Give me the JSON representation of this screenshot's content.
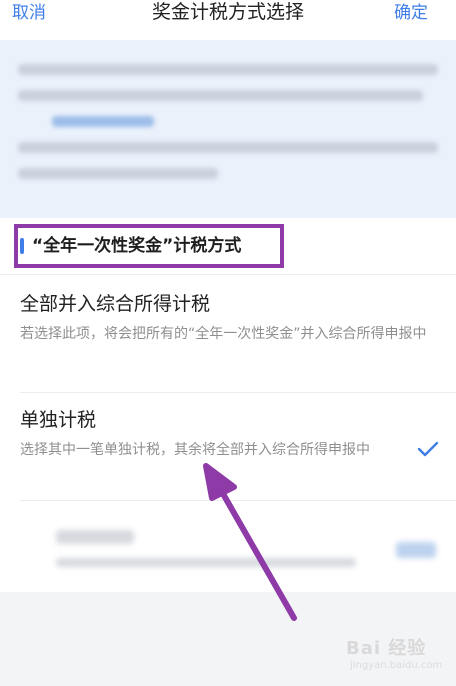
{
  "header": {
    "cancel_label": "取消",
    "title": "奖金计税方式选择",
    "confirm_label": "确定"
  },
  "section": {
    "title": "“全年一次性奖金”计税方式"
  },
  "options": [
    {
      "title": "全部并入综合所得计税",
      "description": "若选择此项，将会把所有的“全年一次性奖金”并入综合所得申报中",
      "selected": false
    },
    {
      "title": "单独计税",
      "description": "选择其中一笔单独计税，其余将全部并入综合所得申报中",
      "selected": true
    }
  ],
  "icons": {
    "selected": "check-icon",
    "annotation": "arrow-annotation"
  },
  "colors": {
    "accent": "#3f7ee8",
    "annotation": "#8e3aa7"
  },
  "watermark": {
    "text": "Bai 经验",
    "sub": "jingyan.baidu.com"
  }
}
